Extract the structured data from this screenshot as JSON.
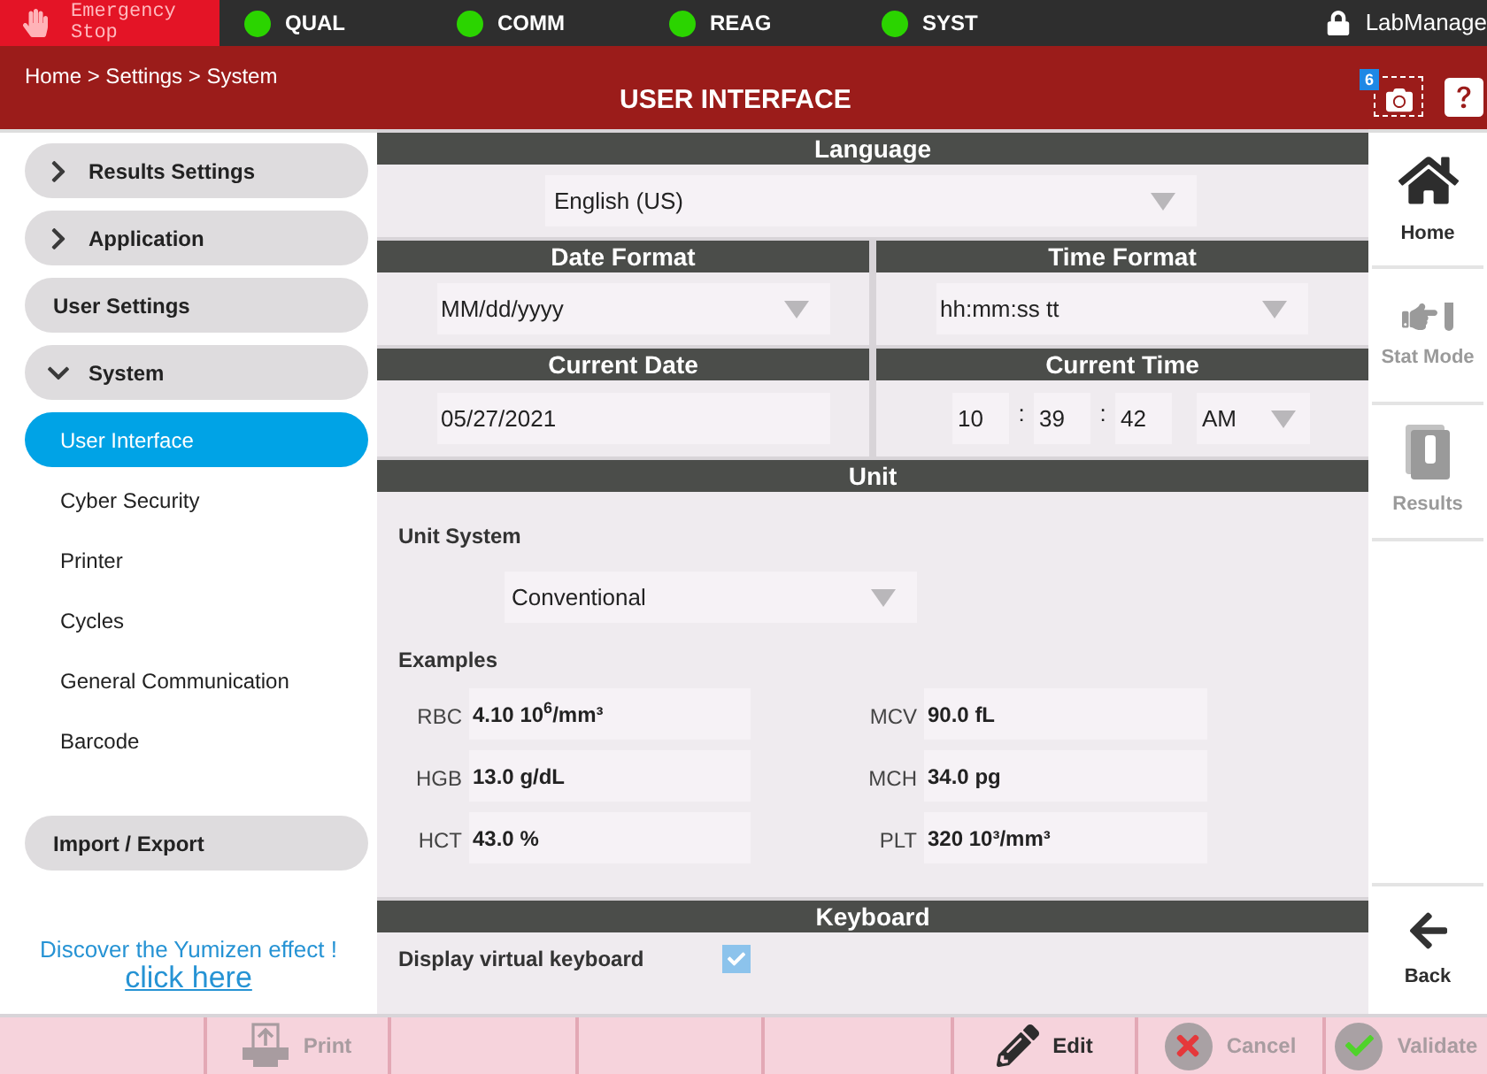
{
  "top_bar": {
    "emergency_stop": "Emergency Stop",
    "indicators": [
      {
        "label": "QUAL",
        "color": "#2bd400"
      },
      {
        "label": "COMM",
        "color": "#2bd400"
      },
      {
        "label": "REAG",
        "color": "#2bd400"
      },
      {
        "label": "SYST",
        "color": "#2bd400"
      }
    ],
    "user": "LabManage"
  },
  "header": {
    "breadcrumb": "Home > Settings > System",
    "title": "USER INTERFACE",
    "snapshot_count": "6"
  },
  "sidebar": {
    "items": [
      {
        "kind": "expandable",
        "label": "Results Settings",
        "expanded": false
      },
      {
        "kind": "expandable",
        "label": "Application",
        "expanded": false
      },
      {
        "kind": "group",
        "label": "User Settings"
      },
      {
        "kind": "expandable",
        "label": "System",
        "expanded": true,
        "children": [
          {
            "label": "User Interface",
            "selected": true
          },
          {
            "label": "Cyber Security",
            "selected": false
          },
          {
            "label": "Printer",
            "selected": false
          },
          {
            "label": "Cycles",
            "selected": false
          },
          {
            "label": "General Communication",
            "selected": false
          },
          {
            "label": "Barcode",
            "selected": false
          }
        ]
      },
      {
        "kind": "group",
        "label": "Import / Export"
      }
    ],
    "promo": {
      "text": "Discover the Yumizen effect !",
      "link": "click here"
    }
  },
  "language": {
    "title": "Language",
    "value": "English (US)"
  },
  "date_format": {
    "title": "Date Format",
    "value": "MM/dd/yyyy"
  },
  "time_format": {
    "title": "Time Format",
    "value": "hh:mm:ss tt"
  },
  "current_date": {
    "title": "Current Date",
    "value": "05/27/2021"
  },
  "current_time": {
    "title": "Current Time",
    "hour": "10",
    "separator_1": ":",
    "minute": "39",
    "separator_2": ":",
    "second": "42",
    "period": "AM"
  },
  "unit": {
    "title": "Unit",
    "system_label": "Unit System",
    "system_value": "Conventional",
    "examples_label": "Examples",
    "examples": [
      {
        "name": "RBC",
        "value": "4.10 10$^{6}$/mm³"
      },
      {
        "name": "MCV",
        "value": "90.0 fL"
      },
      {
        "name": "HGB",
        "value": "13.0 g/dL"
      },
      {
        "name": "MCH",
        "value": "34.0 pg"
      },
      {
        "name": "HCT",
        "value": "43.0 %"
      },
      {
        "name": "PLT",
        "value": "320 10³/mm³"
      }
    ]
  },
  "keyboard": {
    "title": "Keyboard",
    "label": "Display virtual keyboard",
    "checked": true
  },
  "right_nav": {
    "items": [
      {
        "kind": "home",
        "label": "Home",
        "disabled": false
      },
      {
        "kind": "stat",
        "label": "Stat Mode",
        "disabled": true
      },
      {
        "kind": "results",
        "label": "Results",
        "disabled": true
      }
    ],
    "back": {
      "label": "Back"
    }
  },
  "toolbar": [
    {
      "kind": "print",
      "label": "Print",
      "disabled": true
    },
    {
      "kind": "edit",
      "label": "Edit",
      "disabled": false
    },
    {
      "kind": "cancel",
      "label": "Cancel",
      "disabled": true
    },
    {
      "kind": "validate",
      "label": "Validate",
      "disabled": true
    }
  ]
}
